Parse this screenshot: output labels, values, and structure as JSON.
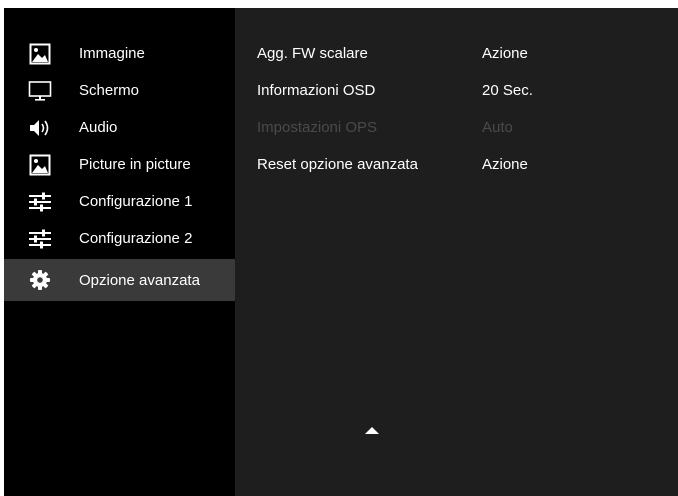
{
  "sidebar": {
    "items": [
      {
        "label": "Immagine",
        "icon": "picture-icon"
      },
      {
        "label": "Schermo",
        "icon": "monitor-icon"
      },
      {
        "label": "Audio",
        "icon": "speaker-icon"
      },
      {
        "label": "Picture in picture",
        "icon": "picture-icon"
      },
      {
        "label": "Configurazione 1",
        "icon": "sliders-icon"
      },
      {
        "label": "Configurazione 2",
        "icon": "sliders-icon"
      },
      {
        "label": "Opzione avanzata",
        "icon": "gear-icon",
        "selected": true
      }
    ]
  },
  "settings": {
    "rows": [
      {
        "label": "Agg. FW scalare",
        "value": "Azione",
        "enabled": true
      },
      {
        "label": "Informazioni OSD",
        "value": "20 Sec.",
        "enabled": true
      },
      {
        "label": "Impostazioni OPS",
        "value": "Auto",
        "enabled": false
      },
      {
        "label": "Reset opzione avanzata",
        "value": "Azione",
        "enabled": true
      }
    ]
  },
  "colors": {
    "sidebar_bg": "#000000",
    "content_bg": "#1e1e1e",
    "selected_bg": "#3a3a3a",
    "text": "#ffffff",
    "disabled_text": "#4a4a4a"
  },
  "scroll_indicator": "scroll-up-arrow-icon"
}
